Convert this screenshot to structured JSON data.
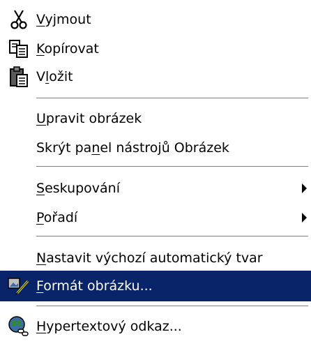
{
  "menu": {
    "items": [
      {
        "pre": "",
        "mn": "V",
        "post": "yjmout",
        "icon": "scissors-icon"
      },
      {
        "pre": "",
        "mn": "K",
        "post": "opírovat",
        "icon": "copy-icon"
      },
      {
        "pre": "V",
        "mn": "l",
        "post": "ožit",
        "icon": "paste-icon"
      },
      {
        "pre": "",
        "mn": "U",
        "post": "pravit obrázek"
      },
      {
        "pre": "Skrýt pa",
        "mn": "n",
        "post": "el nástrojů Obrázek"
      },
      {
        "pre": "",
        "mn": "S",
        "post": "eskupování",
        "submenu": true
      },
      {
        "pre": "",
        "mn": "P",
        "post": "ořadí",
        "submenu": true
      },
      {
        "pre": "",
        "mn": "N",
        "post": "astavit výchozí automatický tvar"
      },
      {
        "pre": "",
        "mn": "F",
        "post": "ormát obrázku...",
        "icon": "format-picture-icon",
        "highlighted": true
      },
      {
        "pre": "",
        "mn": "H",
        "post": "ypertextový odkaz...",
        "icon": "hyperlink-icon"
      }
    ]
  },
  "colors": {
    "highlight": "#0a246a",
    "highlight_text": "#ffffff",
    "text": "#000000",
    "separator": "#808080"
  }
}
